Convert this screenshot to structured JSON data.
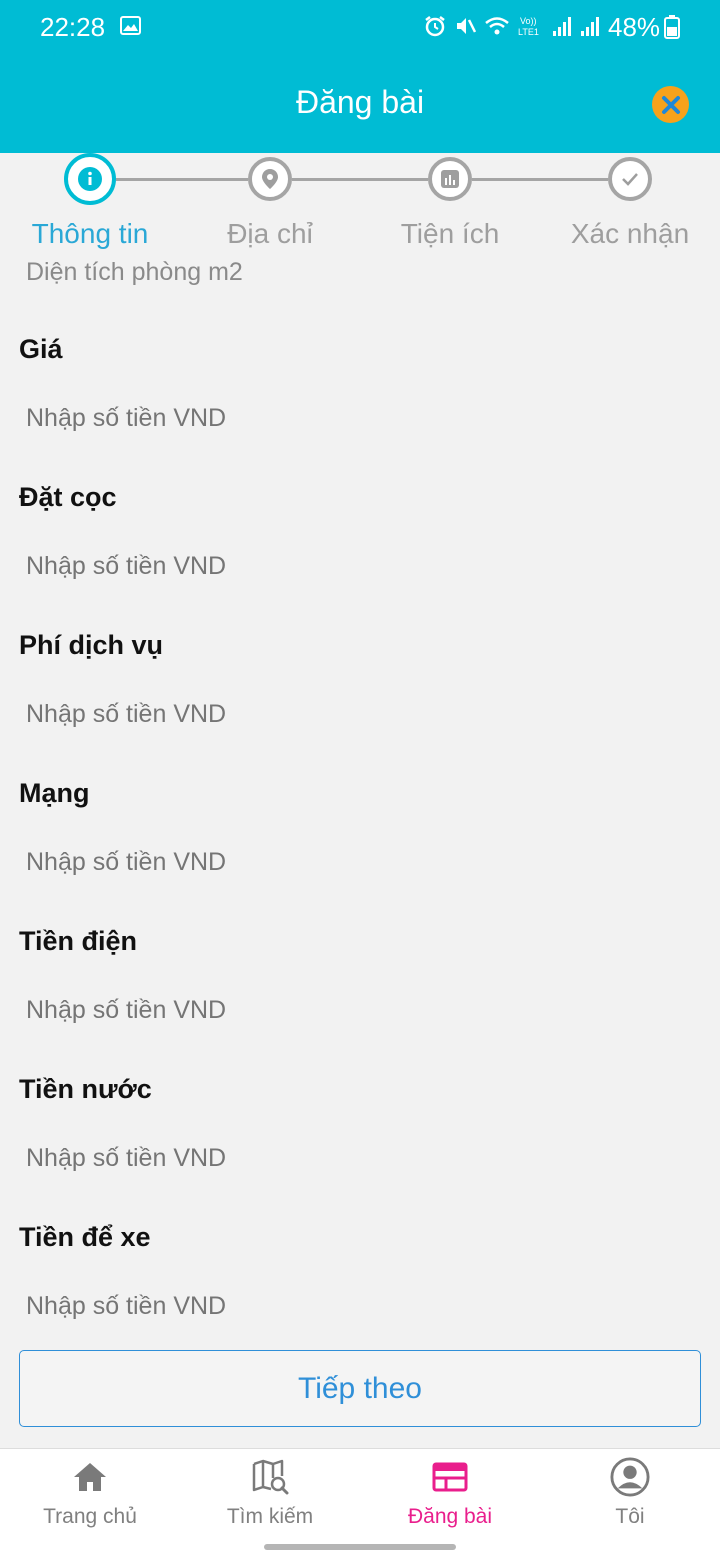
{
  "status_bar": {
    "time": "22:28",
    "battery": "48%",
    "network": "LTE1"
  },
  "header": {
    "title": "Đăng bài",
    "close_icon": "close-icon"
  },
  "stepper": {
    "steps": [
      {
        "label": "Thông tin",
        "icon": "info-icon",
        "active": true
      },
      {
        "label": "Địa chỉ",
        "icon": "location-pin-icon",
        "active": false
      },
      {
        "label": "Tiện ích",
        "icon": "utilities-icon",
        "active": false
      },
      {
        "label": "Xác nhận",
        "icon": "check-icon",
        "active": false
      }
    ]
  },
  "form": {
    "cutoff_text": "Diện tích phòng m2",
    "fields": [
      {
        "label": "Giá",
        "placeholder": "Nhập số tiền VND"
      },
      {
        "label": "Đặt cọc",
        "placeholder": "Nhập số tiền VND"
      },
      {
        "label": "Phí dịch vụ",
        "placeholder": "Nhập số tiền VND"
      },
      {
        "label": "Mạng",
        "placeholder": "Nhập số tiền VND"
      },
      {
        "label": "Tiền điện",
        "placeholder": "Nhập số tiền VND"
      },
      {
        "label": "Tiền nước",
        "placeholder": "Nhập số tiền VND"
      },
      {
        "label": "Tiền để xe",
        "placeholder": "Nhập số tiền VND"
      }
    ],
    "next_button": "Tiếp theo"
  },
  "bottom_nav": {
    "items": [
      {
        "label": "Trang chủ",
        "icon": "home-icon",
        "active": false
      },
      {
        "label": "Tìm kiếm",
        "icon": "map-search-icon",
        "active": false
      },
      {
        "label": "Đăng bài",
        "icon": "post-icon",
        "active": true
      },
      {
        "label": "Tôi",
        "icon": "profile-icon",
        "active": false
      }
    ]
  },
  "colors": {
    "header": "#00bcd4",
    "accent": "#2aa8d6",
    "close_button": "#f7a21b",
    "nav_active": "#e91e8c",
    "button_text": "#2f8fd8"
  }
}
